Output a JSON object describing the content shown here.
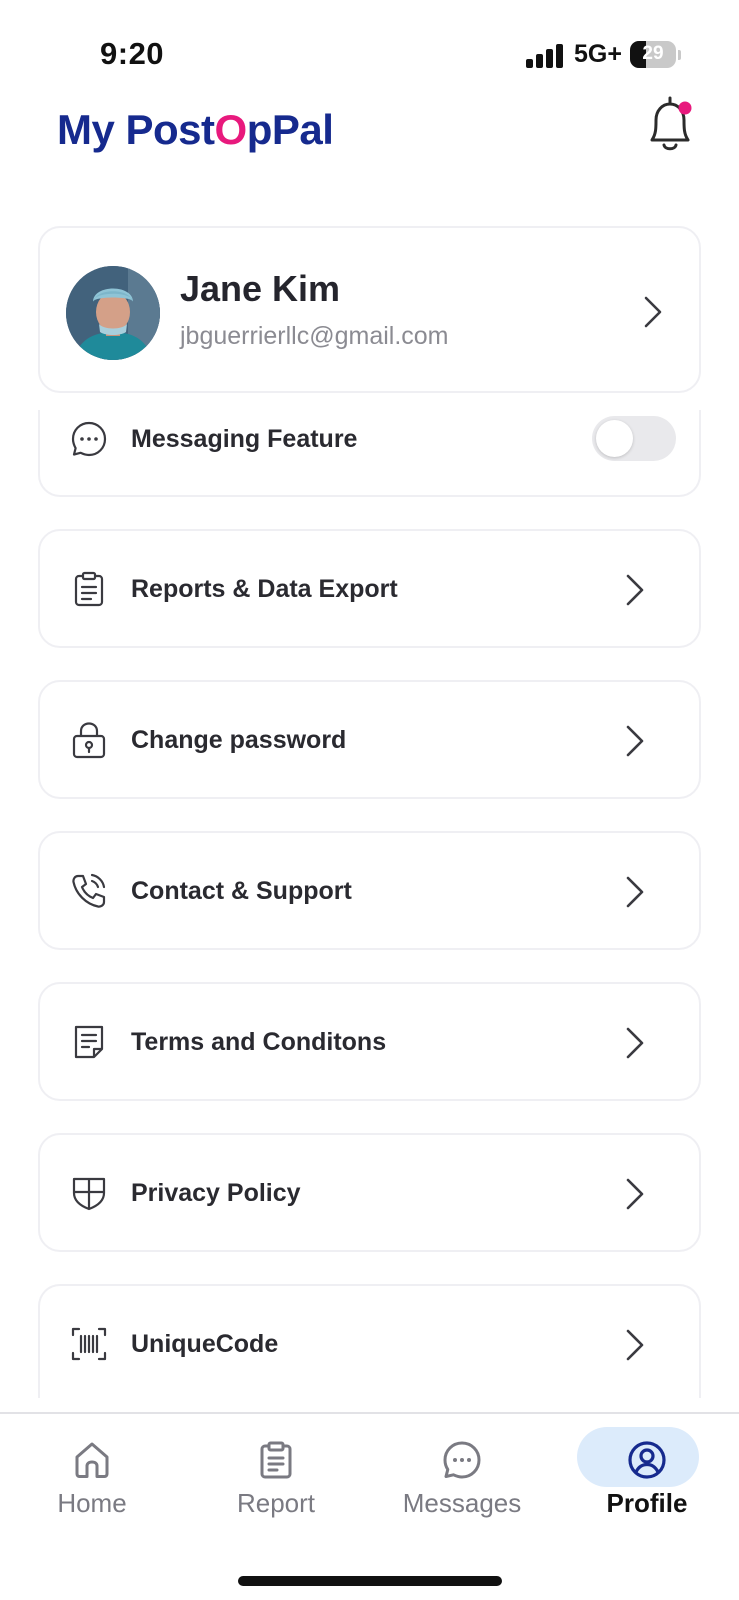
{
  "status_bar": {
    "time": "9:20",
    "network": "5G+",
    "battery": "29"
  },
  "header": {
    "logo_part1": "My Post",
    "logo_glyph": "O",
    "logo_part2": "pPal"
  },
  "profile": {
    "name": "Jane Kim",
    "email": "jbguerrierllc@gmail.com"
  },
  "messaging": {
    "label": "Messaging Feature",
    "enabled": false
  },
  "menu": [
    {
      "label": "Reports & Data Export",
      "icon": "clipboard-icon"
    },
    {
      "label": "Change password",
      "icon": "lock-icon"
    },
    {
      "label": "Contact & Support",
      "icon": "phone-icon"
    },
    {
      "label": "Terms and Conditons",
      "icon": "document-icon"
    },
    {
      "label": "Privacy Policy",
      "icon": "shield-icon"
    },
    {
      "label": "UniqueCode",
      "icon": "barcode-icon"
    }
  ],
  "nav": [
    {
      "label": "Home",
      "icon": "home-icon",
      "active": false
    },
    {
      "label": "Report",
      "icon": "clipboard-icon",
      "active": false
    },
    {
      "label": "Messages",
      "icon": "chat-icon",
      "active": false
    },
    {
      "label": "Profile",
      "icon": "profile-icon",
      "active": true
    }
  ],
  "colors": {
    "brand": "#162a8e",
    "accent": "#e8197d",
    "active_nav_bg": "#dcebfb"
  }
}
